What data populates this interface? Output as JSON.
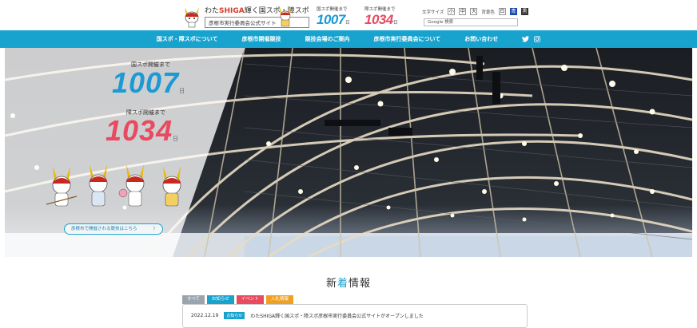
{
  "header": {
    "logo_prefix": "わた",
    "logo_shiga": "SHIGA",
    "logo_suffix": "輝く国スポ・障スポ",
    "logo_subtitle": "彦根市実行委員会公式サイト",
    "counts": [
      {
        "label": "国スポ開催まで",
        "value": "1007",
        "unit": "日",
        "color": "#1b9ad6"
      },
      {
        "label": "障スポ開催まで",
        "value": "1034",
        "unit": "日",
        "color": "#e84a5f"
      }
    ],
    "font_size_label": "文字サイズ",
    "font_small": "小",
    "font_medium": "中",
    "font_large": "大",
    "bg_color_label": "背景色",
    "bg_white": "白",
    "bg_blue": "青",
    "bg_black": "黒",
    "search_placeholder": "Google 検索"
  },
  "nav": {
    "items": [
      "国スポ・障スポについて",
      "彦根市開催競技",
      "競技会場のご案内",
      "彦根市実行委員会について",
      "お問い合わせ"
    ],
    "twitter_icon": "twitter-icon",
    "instagram_icon": "instagram-icon"
  },
  "hero": {
    "count_a_label": "国スポ開催まで",
    "count_a_value": "1007",
    "count_a_unit": "日",
    "count_b_label": "障スポ開催まで",
    "count_b_value": "1034",
    "count_b_unit": "日",
    "link_label": "彦根市で開催される競技はこちら",
    "link_arrow": "〉"
  },
  "news": {
    "title_prefix": "新",
    "title_highlight": "着",
    "title_suffix": "情報",
    "tabs": [
      {
        "label": "すべて",
        "color": "#9aa4ad"
      },
      {
        "label": "お知らせ",
        "color": "#18a3cf"
      },
      {
        "label": "イベント",
        "color": "#e84a5f"
      },
      {
        "label": "入札情報",
        "color": "#f0a020"
      }
    ],
    "items": [
      {
        "date": "2022.12.19",
        "category": "お知らせ",
        "text": "わたSHIGA輝く国スポ・障スポ彦根市実行委員会公式サイトがオープンしました"
      }
    ]
  }
}
